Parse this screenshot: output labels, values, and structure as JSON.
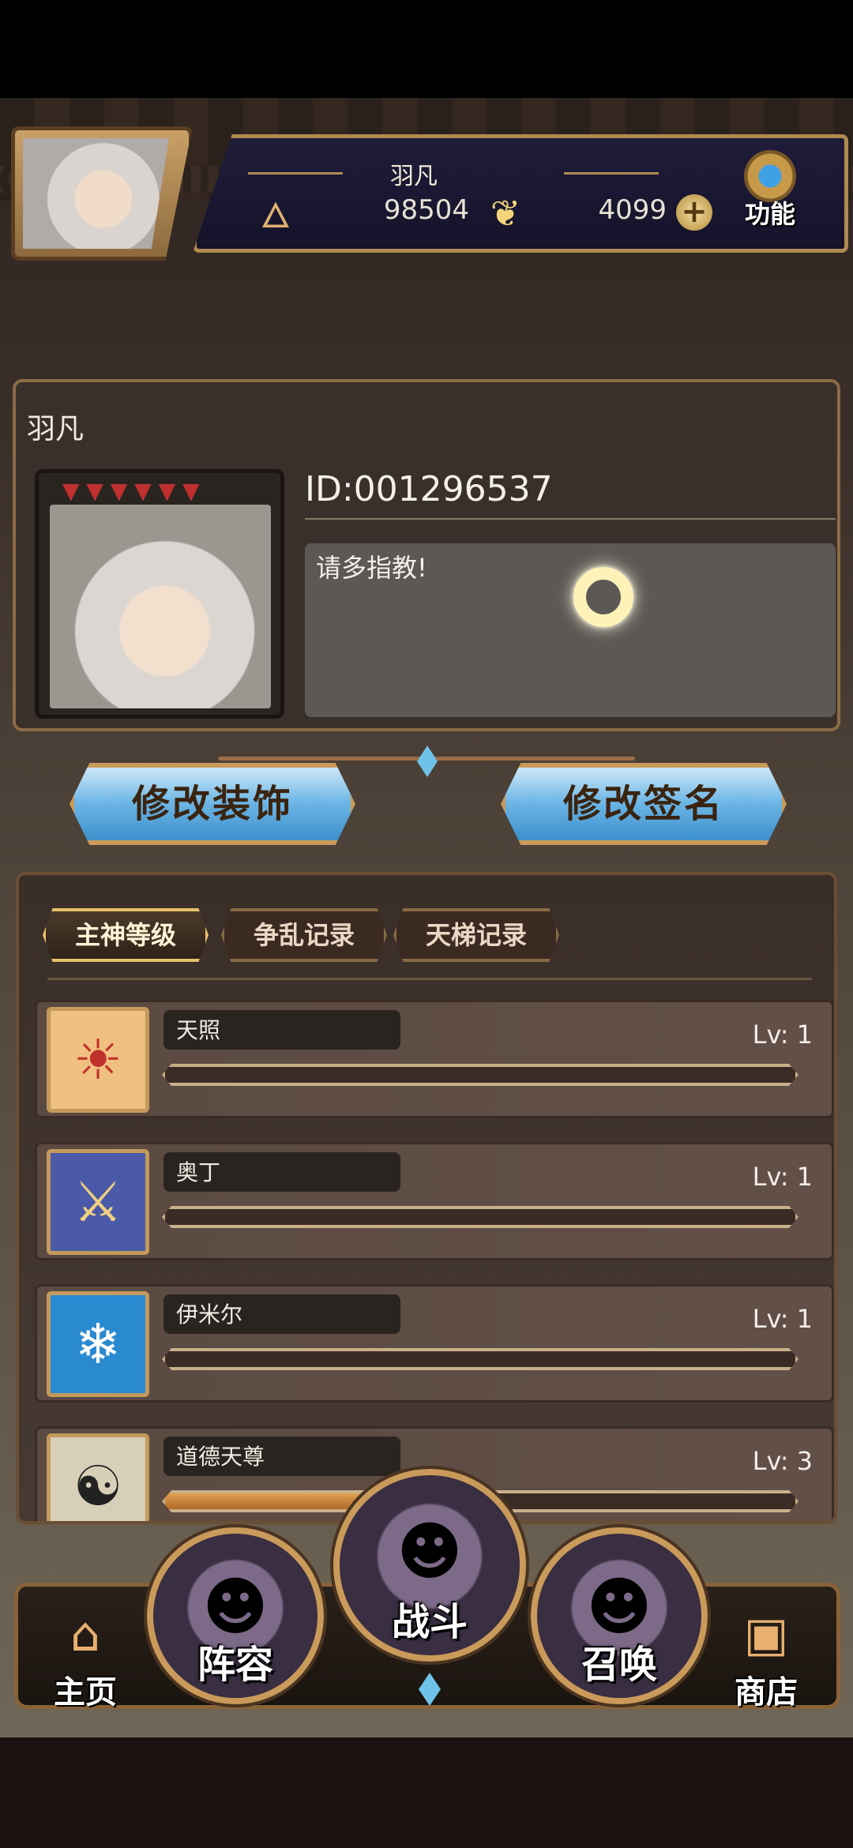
{
  "header": {
    "player_name": "羽凡",
    "resource_1": "98504",
    "resource_2": "4099",
    "resource_1_icon": "flame-icon",
    "resource_2_icon": "butterfly-icon",
    "function_label": "功能"
  },
  "profile": {
    "name": "羽凡",
    "id": "ID:001296537",
    "signature": "请多指教!"
  },
  "actions": {
    "edit_decor": "修改装饰",
    "edit_sign": "修改签名"
  },
  "tabs": [
    {
      "label": "主神等级",
      "active": true
    },
    {
      "label": "争乱记录",
      "active": false
    },
    {
      "label": "天梯记录",
      "active": false
    }
  ],
  "deities": [
    {
      "name": "天照",
      "level": "Lv: 1",
      "progress": 0,
      "icon": "sun-icon",
      "color": "#f0c080"
    },
    {
      "name": "奥丁",
      "level": "Lv: 1",
      "progress": 0,
      "icon": "wings-sword-icon",
      "color": "#4a5aa8"
    },
    {
      "name": "伊米尔",
      "level": "Lv: 1",
      "progress": 0,
      "icon": "ice-giant-icon",
      "color": "#2a8ad0"
    },
    {
      "name": "道德天尊",
      "level": "Lv: 3",
      "progress": 0.47,
      "icon": "yin-yang-icon",
      "color": "#d8cfb8"
    }
  ],
  "nav": {
    "home": "主页",
    "team": "阵容",
    "battle": "战斗",
    "summon": "召唤",
    "shop": "商店"
  }
}
